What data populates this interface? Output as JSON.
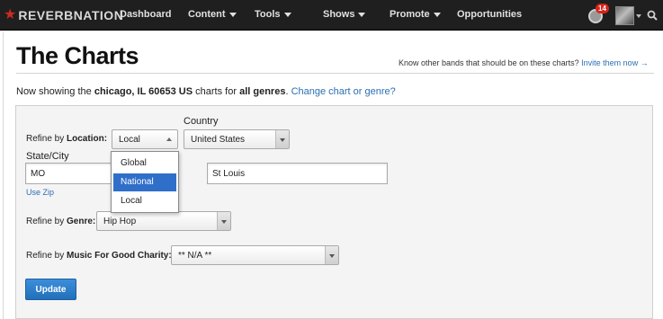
{
  "nav": {
    "logo_text": "REVERBNATION",
    "items": [
      {
        "label": "Dashboard"
      },
      {
        "label": "Content"
      },
      {
        "label": "Tools"
      },
      {
        "label": "Shows"
      },
      {
        "label": "Promote"
      },
      {
        "label": "Opportunities"
      }
    ],
    "notification_count": "14",
    "icons": [
      "star-logo-icon",
      "globe-icon",
      "avatar",
      "search-icon"
    ]
  },
  "page": {
    "title": "The Charts",
    "invite_prompt": "Know other bands that should be on these charts?",
    "invite_link": "Invite them now →",
    "showing_prefix": "Now showing the",
    "showing_location": "chicago, IL 60653 US",
    "showing_mid": "charts for",
    "showing_genre": "all genres",
    "change_link": "Change chart or genre?"
  },
  "form": {
    "refine_location_prefix": "Refine by",
    "refine_location_bold": "Location:",
    "location_selected": "Local",
    "location_options": [
      "Global",
      "National",
      "Local"
    ],
    "location_highlighted": "National",
    "country_label": "Country",
    "country_value": "United States",
    "state_city_label": "State/City",
    "state_value": "MO",
    "city_value": "St Louis",
    "use_zip": "Use Zip",
    "refine_genre_prefix": "Refine by",
    "refine_genre_bold": "Genre:",
    "genre_value": "Hip Hop",
    "refine_charity_prefix": "Refine by",
    "refine_charity_bold": "Music For Good Charity:",
    "charity_value": "** N/A **",
    "update_label": "Update"
  },
  "colors": {
    "topbar": "#1f1f1f",
    "brand_red": "#c92b23",
    "link_blue": "#2a6fb5",
    "button_blue": "#2a7cc8",
    "highlight_blue": "#2f6fc9"
  }
}
